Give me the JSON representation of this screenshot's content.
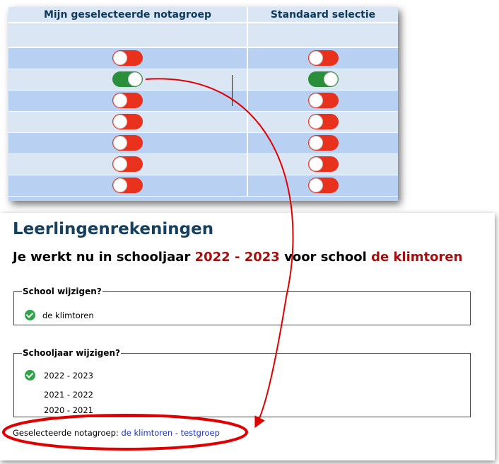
{
  "toggle_table": {
    "headers": [
      "Mijn geselecteerde notagroep",
      "Standaard selectie"
    ],
    "rows": [
      {
        "mine": false,
        "standard": false
      },
      {
        "mine": true,
        "standard": true
      },
      {
        "mine": false,
        "standard": false
      },
      {
        "mine": false,
        "standard": false
      },
      {
        "mine": false,
        "standard": false
      },
      {
        "mine": false,
        "standard": false
      },
      {
        "mine": false,
        "standard": false
      }
    ]
  },
  "page": {
    "title": "Leerlingenrekeningen",
    "subtitle_prefix": "Je werkt nu in schooljaar",
    "subtitle_year": "2022 - 2023",
    "subtitle_middle": "voor school",
    "subtitle_school": "de klimtoren"
  },
  "school_section": {
    "legend": "School wijzigen?",
    "options": [
      {
        "label": "de klimtoren",
        "selected": true
      }
    ]
  },
  "year_section": {
    "legend": "Schooljaar wijzigen?",
    "options": [
      {
        "label": "2022 - 2023",
        "selected": true
      },
      {
        "label": "2021 - 2022",
        "selected": false
      },
      {
        "label": "2020 - 2021",
        "selected": false
      }
    ]
  },
  "selected_group": {
    "label": "Geselecteerde notagroep:",
    "value": "de klimtoren - testgroep"
  },
  "colors": {
    "accent_red": "#a30f0f",
    "title_blue": "#15405f",
    "link_blue": "#1a33c9",
    "toggle_on": "#2a8f3a",
    "toggle_off": "#e8321e",
    "annotation_red": "#e00000"
  },
  "icons": {
    "selected_marker": "check-circle-icon"
  }
}
